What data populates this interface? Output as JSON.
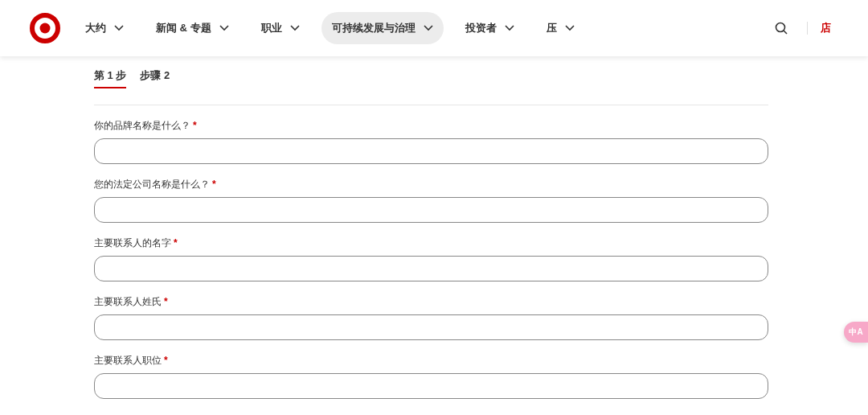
{
  "nav": {
    "items": [
      {
        "label": "大约",
        "selected": false
      },
      {
        "label": "新闻 & 专题",
        "selected": false
      },
      {
        "label": "职业",
        "selected": false
      },
      {
        "label": "可持续发展与治理",
        "selected": true
      },
      {
        "label": "投资者",
        "selected": false
      },
      {
        "label": "压",
        "selected": false
      }
    ],
    "store_link": "店"
  },
  "steps": [
    {
      "label": "第 1 步",
      "selected": true
    },
    {
      "label": "步骤 2",
      "selected": false
    }
  ],
  "fields": [
    {
      "label": "你的品牌名称是什么？",
      "required_mark": "*"
    },
    {
      "label": "您的法定公司名称是什么？",
      "required_mark": "*"
    },
    {
      "label": "主要联系人的名字",
      "required_mark": "*"
    },
    {
      "label": "主要联系人姓氏",
      "required_mark": "*"
    },
    {
      "label": "主要联系人职位",
      "required_mark": "*"
    }
  ],
  "translate_button": {
    "label": "中A"
  }
}
